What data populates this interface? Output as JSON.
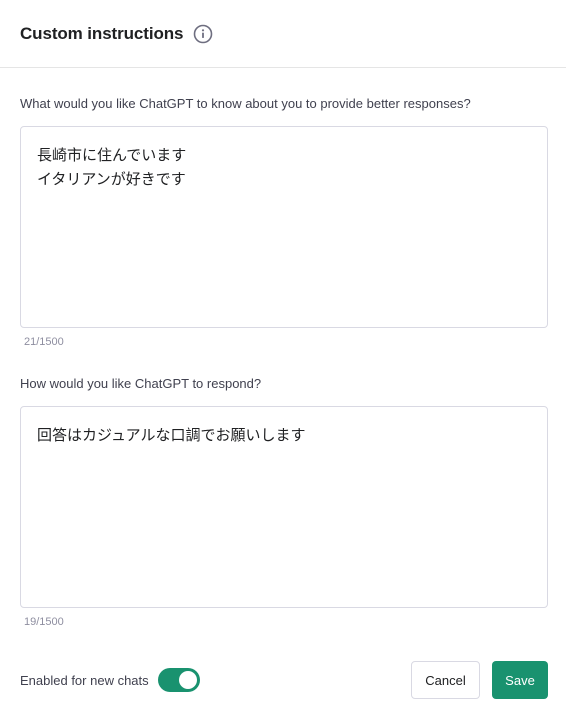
{
  "dialog": {
    "title": "Custom instructions",
    "info_icon": "info-icon"
  },
  "about_you": {
    "label": "What would you like ChatGPT to know about you to provide better responses?",
    "lines": [
      "長崎市に住んでいます",
      "イタリアンが好きです"
    ],
    "counter": "21/1500"
  },
  "respond": {
    "label": "How would you like ChatGPT to respond?",
    "lines": [
      "回答はカジュアルな口調でお願いします"
    ],
    "counter": "19/1500"
  },
  "footer": {
    "toggle_label": "Enabled for new chats",
    "toggle_on": true,
    "cancel_label": "Cancel",
    "save_label": "Save"
  },
  "colors": {
    "accent": "#19926f",
    "border": "#d9d9e3",
    "muted_text": "#8e8ea0"
  }
}
